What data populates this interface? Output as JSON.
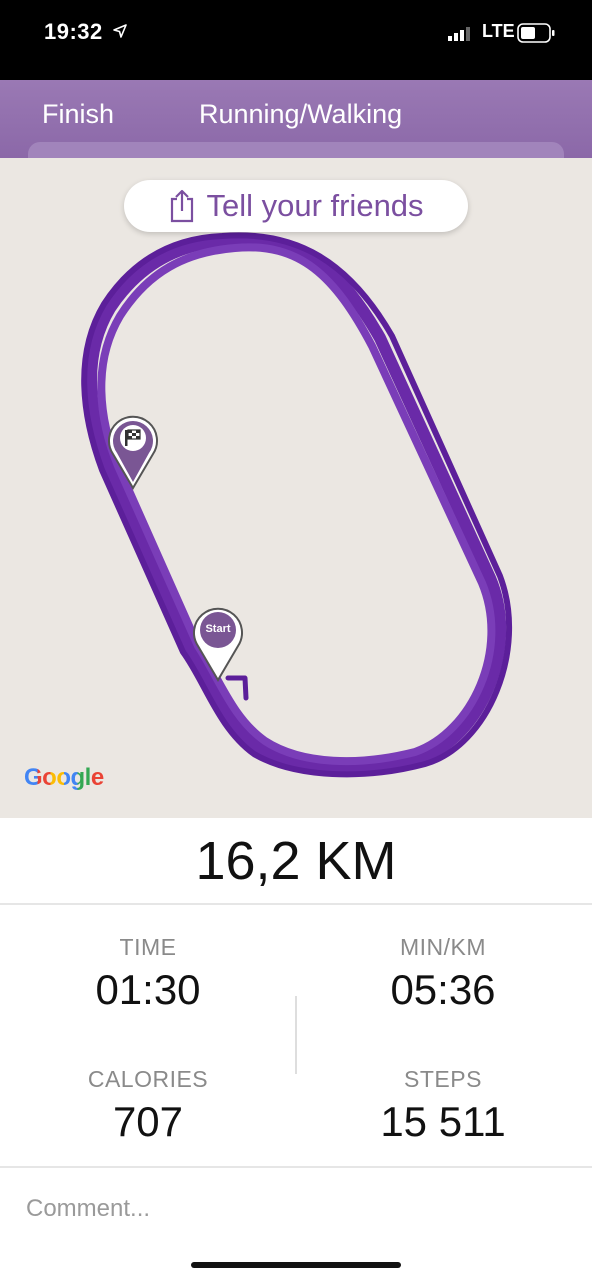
{
  "status_bar": {
    "time": "19:32",
    "network": "LTE",
    "icons": [
      "location-arrow-icon",
      "signal-icon",
      "battery-icon"
    ]
  },
  "header": {
    "finish_label": "Finish",
    "title": "Running/Walking",
    "background_color": "#8b68a8"
  },
  "map": {
    "share_button_label": "Tell your friends",
    "share_icon": "share-icon",
    "route_color": "#6a2aa8",
    "markers": [
      {
        "name": "finish-flag-icon",
        "label": ""
      },
      {
        "name": "start-marker-icon",
        "label": "Start"
      }
    ],
    "attribution": "Google"
  },
  "summary": {
    "distance": "16,2 KM"
  },
  "stats": {
    "time": {
      "label": "TIME",
      "value": "01:30"
    },
    "pace": {
      "label": "MIN/KM",
      "value": "05:36"
    },
    "calories": {
      "label": "CALORIES",
      "value": "707"
    },
    "steps": {
      "label": "STEPS",
      "value": "15 511"
    }
  },
  "comment": {
    "placeholder": "Comment..."
  }
}
